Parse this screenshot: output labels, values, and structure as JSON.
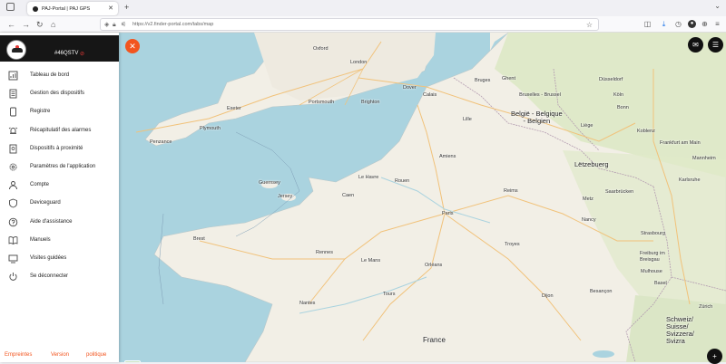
{
  "browser": {
    "tab_title": "PAJ-Portal | PAJ GPS",
    "tab_close": "✕",
    "new_tab": "+",
    "url": "https://v2.finder-portal.com/tabs/map"
  },
  "header": {
    "device_name": "#46QSTV",
    "warning_icon": "⊘"
  },
  "menu": {
    "items": [
      {
        "label": "Tableau de bord",
        "icon": "dashboard-icon"
      },
      {
        "label": "Gestion des dispositifs",
        "icon": "device-management-icon"
      },
      {
        "label": "Registre",
        "icon": "register-icon"
      },
      {
        "label": "Récapitulatif des alarmes",
        "icon": "alarm-icon"
      },
      {
        "label": "Dispositifs à proximité",
        "icon": "nearby-icon"
      },
      {
        "label": "Paramètres de l'application",
        "icon": "gear-icon"
      },
      {
        "label": "Compte",
        "icon": "user-icon"
      },
      {
        "label": "Deviceguard",
        "icon": "shield-icon"
      },
      {
        "label": "Aide d'assistance",
        "icon": "help-icon"
      },
      {
        "label": "Manuels",
        "icon": "book-icon"
      },
      {
        "label": "Visites guidées",
        "icon": "tour-icon"
      },
      {
        "label": "Se déconnecter",
        "icon": "power-icon"
      }
    ]
  },
  "footer": {
    "imprint": "Empreintes",
    "version": "Version",
    "policy": "politique"
  },
  "controls": {
    "close_symbol": "✕",
    "zoom_in": "+"
  },
  "map": {
    "cities": [
      {
        "name": "Oxford"
      },
      {
        "name": "London"
      },
      {
        "name": "Exeter"
      },
      {
        "name": "Portsmouth"
      },
      {
        "name": "Brighton"
      },
      {
        "name": "Plymouth"
      },
      {
        "name": "Dover"
      },
      {
        "name": "Calais"
      },
      {
        "name": "Bruges"
      },
      {
        "name": "Ghent"
      },
      {
        "name": "Bruxelles - Brussel"
      },
      {
        "name": "Liège"
      },
      {
        "name": "Düsseldorf"
      },
      {
        "name": "Köln"
      },
      {
        "name": "Bonn"
      },
      {
        "name": "Koblenz"
      },
      {
        "name": "Frankfurt am Main"
      },
      {
        "name": "Lille"
      },
      {
        "name": "Amiens"
      },
      {
        "name": "Le Havre"
      },
      {
        "name": "Rouen"
      },
      {
        "name": "Caen"
      },
      {
        "name": "Guernsey"
      },
      {
        "name": "Jersey"
      },
      {
        "name": "Paris"
      },
      {
        "name": "Reims"
      },
      {
        "name": "Metz"
      },
      {
        "name": "Saarbrücken"
      },
      {
        "name": "Nancy"
      },
      {
        "name": "Strasbourg"
      },
      {
        "name": "Brest"
      },
      {
        "name": "Rennes"
      },
      {
        "name": "Le Mans"
      },
      {
        "name": "Orléans"
      },
      {
        "name": "Troyes"
      },
      {
        "name": "Nantes"
      },
      {
        "name": "Tours"
      },
      {
        "name": "Dijon"
      },
      {
        "name": "Besançon"
      },
      {
        "name": "Mulhouse"
      },
      {
        "name": "Freiburg im Breisgau"
      },
      {
        "name": "Basel"
      },
      {
        "name": "Zürich"
      },
      {
        "name": "Karlsruhe"
      },
      {
        "name": "Mannheim"
      },
      {
        "name": "Penzance"
      }
    ],
    "countries": [
      {
        "name": "België - Belgique\n- Belgien"
      },
      {
        "name": "Lëtzebuerg"
      },
      {
        "name": "France"
      },
      {
        "name": "Schweiz/\nSuisse/\nSvizzera/\nSvizra"
      }
    ]
  }
}
